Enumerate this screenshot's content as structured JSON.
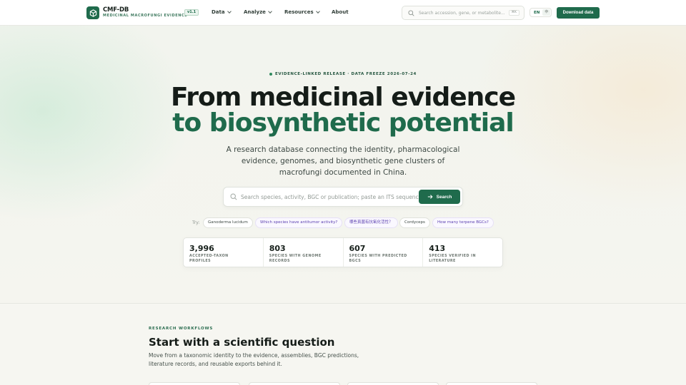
{
  "header": {
    "logo_title": "CMF-DB",
    "logo_subtitle": "MEDICINAL MACROFUNGI EVIDENCE",
    "version": "v1.1",
    "nav": [
      {
        "label": "Data",
        "has_menu": true
      },
      {
        "label": "Analyze",
        "has_menu": true
      },
      {
        "label": "Resources",
        "has_menu": true
      },
      {
        "label": "About",
        "has_menu": false
      }
    ],
    "search_placeholder": "Search accession, gene, or metabolite...",
    "search_shortcut": "⌘K",
    "lang_current": "EN",
    "lang_alt": "中",
    "download_label": "Download data",
    "colors": {
      "accent": "#1f6b4c"
    }
  },
  "hero": {
    "eyebrow": "EVIDENCE-LINKED RELEASE · DATA FREEZE 2026-07-24",
    "title_line1": "From medicinal evidence",
    "title_line2": "to biosynthetic potential",
    "description": "A research database connecting the identity, pharmacological evidence, genomes, and biosynthetic gene clusters of macrofungi documented in China.",
    "search_placeholder": "Search species, activity, BGC or publication; paste an ITS sequence...",
    "search_button": "Search",
    "try_label": "Try:",
    "chips": [
      {
        "label": "Ganoderma lucidum",
        "kind": "term"
      },
      {
        "label": "Which species have antitumor activity?",
        "kind": "question"
      },
      {
        "label": "哪些真菌有抗氧化活性？",
        "kind": "question"
      },
      {
        "label": "Cordyceps",
        "kind": "term"
      },
      {
        "label": "How many terpene BGCs?",
        "kind": "question"
      }
    ]
  },
  "stats": [
    {
      "value": "3,996",
      "label": "ACCEPTED-TAXON PROFILES"
    },
    {
      "value": "803",
      "label": "SPECIES WITH GENOME RECORDS"
    },
    {
      "value": "607",
      "label": "SPECIES WITH PREDICTED BGCS"
    },
    {
      "value": "413",
      "label": "SPECIES VERIFIED IN LITERATURE"
    }
  ],
  "workflows": {
    "eyebrow": "RESEARCH WORKFLOWS",
    "title": "Start with a scientific question",
    "description": "Move from a taxonomic identity to the evidence, assemblies, BGC predictions, literature records, and reusable exports behind it."
  }
}
